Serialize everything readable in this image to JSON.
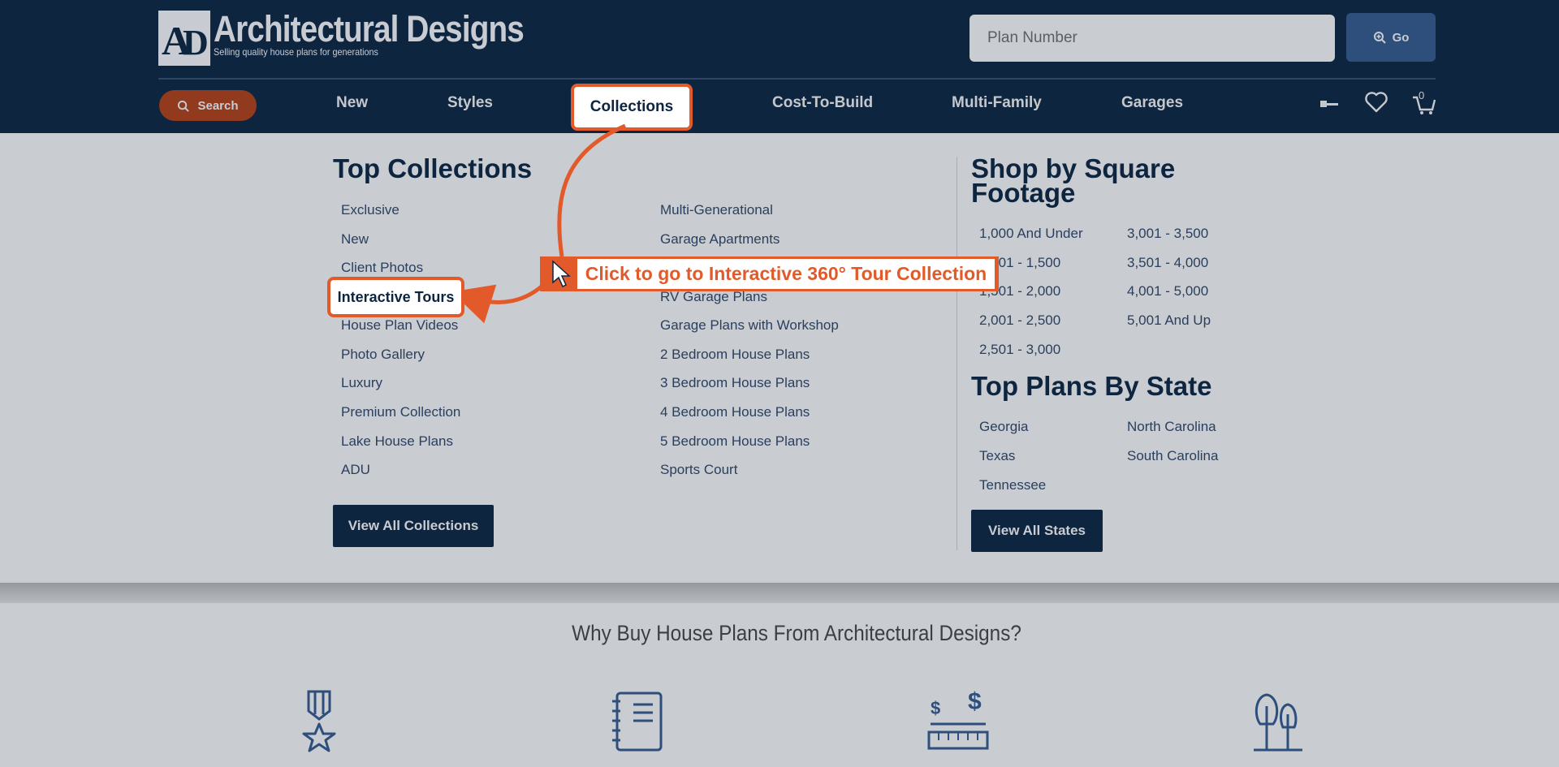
{
  "header": {
    "logo_mark": "AD",
    "logo_title": "Architectural Designs",
    "logo_tagline": "Selling quality house plans for generations",
    "plan_search_placeholder": "Plan Number",
    "go_label": "Go",
    "search_label": "Search",
    "cart_count": "0"
  },
  "nav": {
    "items": [
      "New",
      "Styles",
      "Collections",
      "Cost-To-Build",
      "Multi-Family",
      "Garages"
    ]
  },
  "dropdown": {
    "top_collections": {
      "heading": "Top Collections",
      "col1": [
        "Exclusive",
        "New",
        "Client Photos",
        "Interactive Tours",
        "House Plan Videos",
        "Photo Gallery",
        "Luxury",
        "Premium Collection",
        "Lake House Plans",
        "ADU"
      ],
      "col2": [
        "Multi-Generational",
        "Garage Apartments",
        "",
        "RV Garage Plans",
        "Garage Plans with Workshop",
        "2 Bedroom House Plans",
        "3 Bedroom House Plans",
        "4 Bedroom House Plans",
        "5 Bedroom House Plans",
        "Sports Court"
      ],
      "button": "View All Collections"
    },
    "square_footage": {
      "heading_line1": "Shop by Square",
      "heading_line2": "Footage",
      "col1": [
        "1,000 And Under",
        "1,001 - 1,500",
        "1,501 - 2,000",
        "2,001 - 2,500",
        "2,501 - 3,000"
      ],
      "col2": [
        "3,001 - 3,500",
        "3,501 - 4,000",
        "4,001 - 5,000",
        "5,001 And Up"
      ]
    },
    "states": {
      "heading": "Top Plans By State",
      "col1": [
        "Georgia",
        "Texas",
        "Tennessee"
      ],
      "col2": [
        "North Carolina",
        "South Carolina"
      ],
      "button": "View All States"
    }
  },
  "why_heading": "Why Buy House Plans From Architectural Designs?",
  "callout": {
    "text": "Click to go to Interactive 360° Tour Collection",
    "color": "#e35a2a"
  },
  "colors": {
    "navy": "#0e2540",
    "accent": "#e35a2a"
  }
}
